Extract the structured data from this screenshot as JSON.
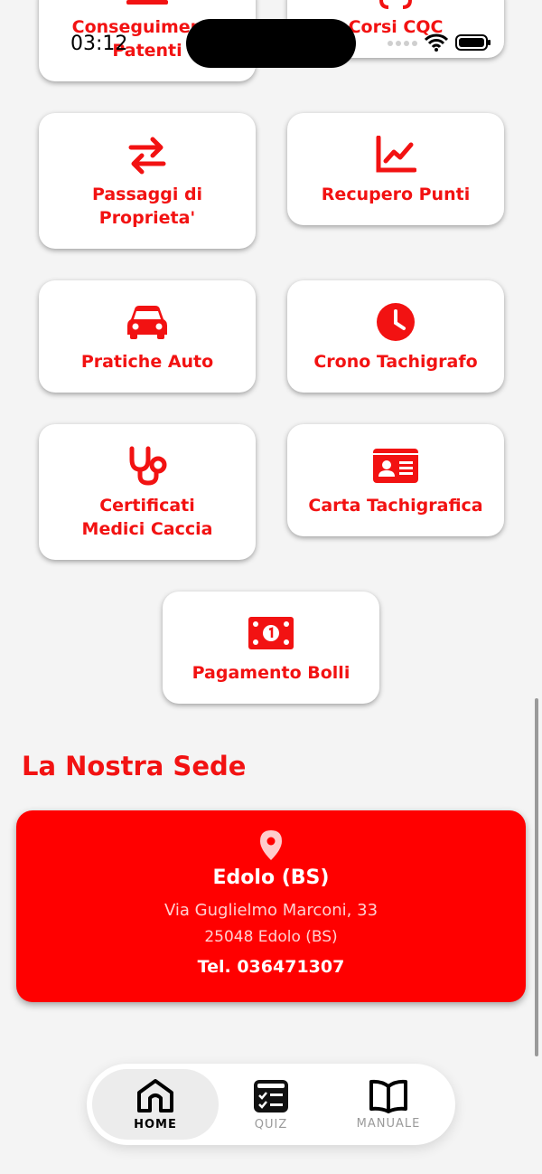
{
  "status": {
    "time": "03:12"
  },
  "top_cards": [
    {
      "label": "Conseguimento\nPatenti"
    },
    {
      "label": "Corsi CQC"
    }
  ],
  "services": [
    {
      "id": "passaggi",
      "label": "Passaggi di\nProprieta'",
      "icon": "swap-arrows-icon"
    },
    {
      "id": "recupero",
      "label": "Recupero Punti",
      "icon": "chart-line-icon"
    },
    {
      "id": "pratiche",
      "label": "Pratiche Auto",
      "icon": "car-icon"
    },
    {
      "id": "crono",
      "label": "Crono Tachigrafo",
      "icon": "clock-icon"
    },
    {
      "id": "certificati",
      "label": "Certificati\nMedici Caccia",
      "icon": "stethoscope-icon"
    },
    {
      "id": "carta",
      "label": "Carta Tachigrafica",
      "icon": "id-card-icon"
    },
    {
      "id": "bolli",
      "label": "Pagamento Bolli",
      "icon": "money-bill-icon"
    }
  ],
  "sede": {
    "title": "La Nostra Sede",
    "city": "Edolo (BS)",
    "address_line1": "Via Guglielmo Marconi, 33",
    "address_line2": "25048 Edolo (BS)",
    "phone": "Tel. 036471307"
  },
  "nav": [
    {
      "label": "HOME",
      "active": true
    },
    {
      "label": "QUIZ",
      "active": false
    },
    {
      "label": "MANUALE",
      "active": false
    }
  ],
  "colors": {
    "accent": "#ff0000",
    "text_red": "#f21212",
    "background": "#f4f4f4"
  }
}
